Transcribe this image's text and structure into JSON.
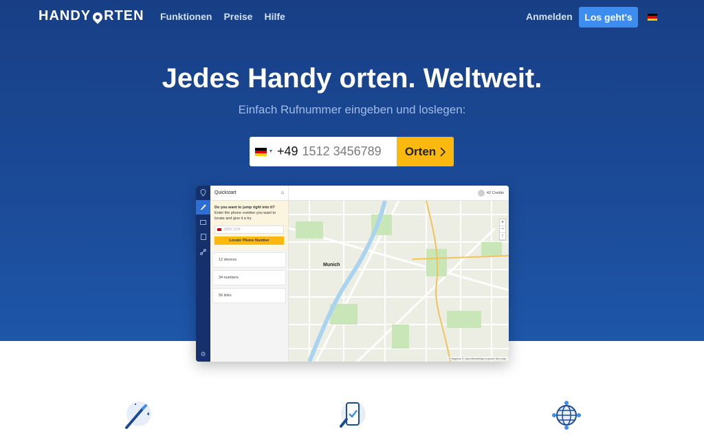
{
  "nav": {
    "logo_left": "HANDY",
    "logo_right": "RTEN",
    "menu": [
      "Funktionen",
      "Preise",
      "Hilfe"
    ],
    "login": "Anmelden",
    "cta": "Los geht's",
    "language_flag": "de-flag"
  },
  "hero": {
    "headline": "Jedes Handy orten. Weltweit.",
    "subline": "Einfach Rufnummer eingeben und loslegen:"
  },
  "search": {
    "country_flag": "de-flag",
    "dial_code": "+49",
    "placeholder": "1512 3456789",
    "button_label": "Orten"
  },
  "app_preview": {
    "panel_title": "Quickstart",
    "quickstart_question": "Do you want to jump right into it?",
    "quickstart_text": "Enter the phone number you want to locate and give it a try.",
    "phone_placeholder": "5656 1234",
    "locate_button": "Locate Phone Number",
    "stats": [
      "12 devices",
      "34 numbers",
      "56 links"
    ],
    "credits": "42 Credits",
    "map_city_label": "Munich",
    "map_zoom_in": "+",
    "map_zoom_out": "−",
    "map_compass": "↑",
    "map_attribution": "© Mapbox © OpenStreetMap Improve this map"
  },
  "colors": {
    "hero_top": "#183f86",
    "hero_bottom": "#1e56a8",
    "accent_yellow": "#fbb80f",
    "cta_blue": "#3d8cf0",
    "rail_navy": "#16306c"
  },
  "features": [
    "magic-wand-icon",
    "phone-check-icon",
    "globe-network-icon"
  ]
}
